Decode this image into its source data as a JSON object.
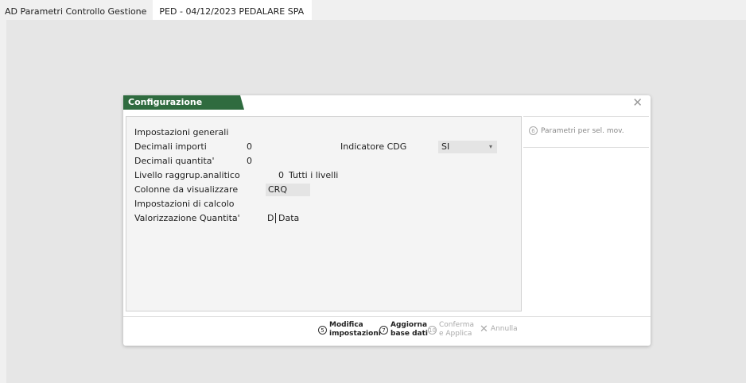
{
  "titlebar": {
    "app_title": "AD Parametri Controllo Gestione",
    "company": "PED - 04/12/2023 PEDALARE SPA"
  },
  "dialog": {
    "title": "Configurazione funzionale",
    "close_icon": "close-x",
    "fields": {
      "impostazioni_generali": "Impostazioni generali",
      "decimali_importi_label": "Decimali importi",
      "decimali_importi_value": "0",
      "decimali_quantita_label": "Decimali quantita'",
      "decimali_quantita_value": "0",
      "livello_label": "Livello raggrup.analitico",
      "livello_value": "0",
      "livello_desc": "Tutti i livelli",
      "colonne_label": "Colonne da visualizzare",
      "colonne_value": "CRQ",
      "impostazioni_calcolo": "Impostazioni di calcolo",
      "valorizzazione_label": "Valorizzazione Quantita'",
      "valorizzazione_code": "D",
      "valorizzazione_desc": "Data",
      "indicatore_label": "Indicatore CDG",
      "indicatore_value": "SI"
    },
    "side": {
      "param_key": "6",
      "param_label": "Parametri per sel. mov."
    },
    "footer": {
      "modifica_key": "5",
      "modifica_line1": "Modifica",
      "modifica_line2": "impostazioni",
      "aggiorna_key": "7",
      "aggiorna_line1": "Aggiorna",
      "aggiorna_line2": "base dati",
      "conferma_key": "10",
      "conferma_line1": "Conferma",
      "conferma_line2": "e Applica",
      "annulla_label": "Annulla"
    }
  },
  "colors": {
    "title_tab": "#2f6b3f",
    "background": "#e6e6e6",
    "disabled": "#aaaaaa"
  }
}
